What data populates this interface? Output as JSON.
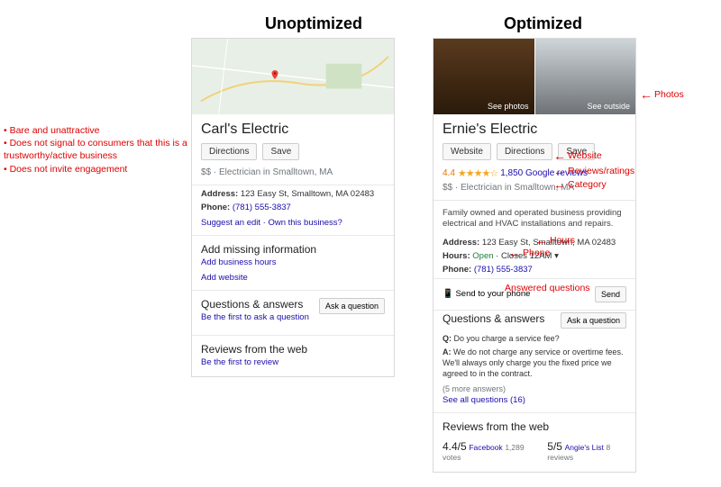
{
  "headers": {
    "left": "Unoptimized",
    "right": "Optimized"
  },
  "left_bullets": [
    "Bare and unattractive",
    "Does not signal to consumers that this is a trustworthy/active business",
    "Does not invite engagement"
  ],
  "annotations": {
    "photos": "Photos",
    "website": "Website",
    "reviews": "Reviews/ratings",
    "category": "Category",
    "hours": "Hours",
    "phone": "Phone",
    "answered": "Answered questions"
  },
  "unopt": {
    "title": "Carl's Electric",
    "buttons": {
      "directions": "Directions",
      "save": "Save"
    },
    "meta": "$$ · Electrician in Smalltown, MA",
    "address_label": "Address:",
    "address": "123 Easy St, Smalltown, MA 02483",
    "phone_label": "Phone:",
    "phone": "(781) 555-3837",
    "suggest": "Suggest an edit · Own this business?",
    "missing_title": "Add missing information",
    "add_hours": "Add business hours",
    "add_website": "Add website",
    "qa_title": "Questions & answers",
    "qa_link": "Be the first to ask a question",
    "ask": "Ask a question",
    "reviews_title": "Reviews from the web",
    "reviews_link": "Be the first to review"
  },
  "opt": {
    "photo_labels": {
      "inside": "See photos",
      "outside": "See outside"
    },
    "title": "Ernie's Electric",
    "buttons": {
      "website": "Website",
      "directions": "Directions",
      "save": "Save"
    },
    "rating": "4.4",
    "stars": "★★★★☆",
    "review_count": "1,850 Google reviews",
    "meta": "$$ · Electrician in Smalltown, MA",
    "description": "Family owned and operated business providing electrical and HVAC installations and repairs.",
    "address_label": "Address:",
    "address": "123 Easy St, Smalltown, MA 02483",
    "hours_label": "Hours:",
    "hours_status": "Open",
    "hours_close": "· Closes 12AM ▾",
    "phone_label": "Phone:",
    "phone": "(781) 555-3837",
    "send_label": "📱 Send to your phone",
    "send_btn": "Send",
    "qa_title": "Questions & answers",
    "ask": "Ask a question",
    "q_label": "Q:",
    "q_text": "Do you charge a service fee?",
    "a_label": "A:",
    "a_text": "We do not charge any service or overtime fees. We'll always only charge you the fixed price we agreed to in the contract.",
    "more_answers": "(5 more answers)",
    "all_q": "See all questions (16)",
    "webreviews_title": "Reviews from the web",
    "web1": {
      "score": "4.4/5",
      "src": "Facebook",
      "cnt": "1,289 votes"
    },
    "web2": {
      "score": "5/5",
      "src": "Angie's List",
      "cnt": "8 reviews"
    }
  }
}
